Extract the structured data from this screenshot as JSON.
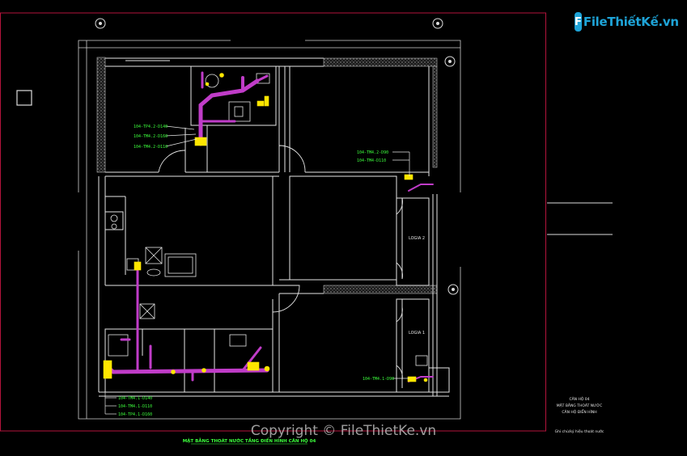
{
  "branding": {
    "logo_text": "FileThiếtKế.vn",
    "watermark": "Copyright © FileThietKe.vn"
  },
  "rooms": {
    "logia_2": "LOGIA 2",
    "logia_1": "LOGIA 1"
  },
  "pipe_labels": {
    "upper_left": [
      "104-TP4.2-D140",
      "104-TM4.2-D160",
      "104-TM4.2-D110"
    ],
    "upper_right": [
      "104-TM4.2-D90",
      "104-TM4-D110"
    ],
    "lower_right": "104-TM4.1-D90",
    "lower_left": [
      "104-TM4.1-D140",
      "104-TM4.1-D110",
      "104-TP4.1-D160"
    ]
  },
  "drawing_caption": "MẶT BẰNG THOÁT NƯỚC TẦNG ĐIỂN HÌNH CĂN HỘ 04",
  "right_notes": [
    "CĂN HỘ 04",
    "MẶT BẰNG THOÁT NƯỚC",
    "CĂN HỘ ĐIỂN HÌNH"
  ],
  "right_footer": "Ghi chú/ký hiệu thoát nước",
  "colors": {
    "background": "#000000",
    "wall": "#e6e6e6",
    "pipe": "#c03cc8",
    "label": "#3cff3c",
    "fixture": "#ffe600",
    "frame": "#b4143c",
    "hatch": "#9a9a9a"
  }
}
